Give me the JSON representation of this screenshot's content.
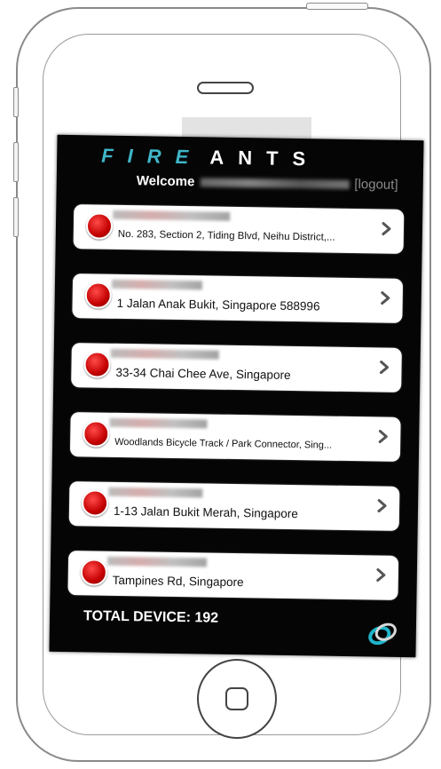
{
  "app": {
    "logo_fire": "FIRE",
    "logo_ants": "ANTS",
    "welcome_label": "Welcome",
    "logout_label": "[logout]"
  },
  "devices": [
    {
      "address": "No. 283, Section 2, Tiding Blvd, Neihu District,..."
    },
    {
      "address": "1 Jalan Anak Bukit, Singapore 588996"
    },
    {
      "address": "33-34 Chai Chee Ave, Singapore"
    },
    {
      "address": "Woodlands Bicycle Track / Park Connector, Sing..."
    },
    {
      "address": "1-13 Jalan Bukit Merah, Singapore"
    },
    {
      "address": "Tampines Rd, Singapore"
    }
  ],
  "footer": {
    "total_label": "TOTAL DEVICE: 192"
  },
  "colors": {
    "accent": "#3fb6c9",
    "status_dot": "#c40000",
    "screen_bg": "#050505"
  },
  "icons": [
    "chevron-right-icon",
    "status-dot-icon",
    "brand-logo-icon"
  ]
}
